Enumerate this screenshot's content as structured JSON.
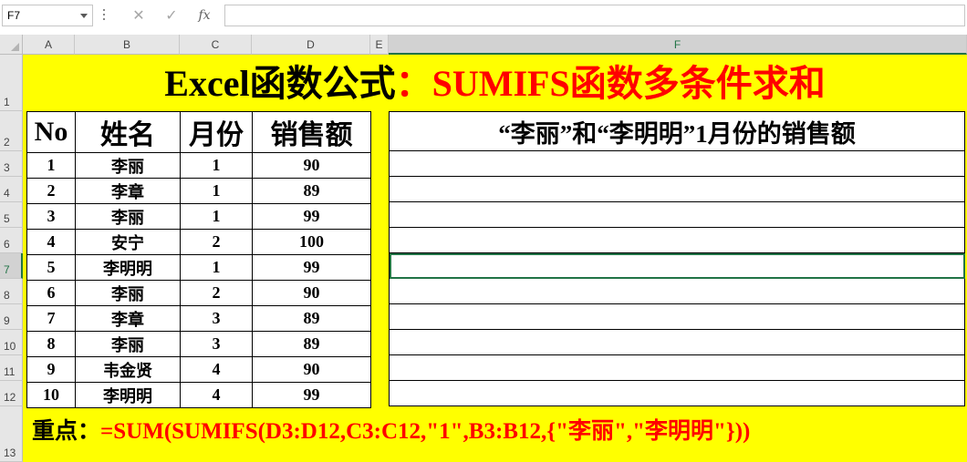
{
  "formula_bar": {
    "name_box": "F7",
    "cancel_glyph": "✕",
    "enter_glyph": "✓",
    "fx_label": "fx",
    "formula": ""
  },
  "columns": [
    "A",
    "B",
    "C",
    "D",
    "E",
    "F"
  ],
  "rows": [
    "1",
    "2",
    "3",
    "4",
    "5",
    "6",
    "7",
    "8",
    "9",
    "10",
    "11",
    "12",
    "13"
  ],
  "selected_cell": "F7",
  "title": {
    "black": "Excel函数公式",
    "red": "：SUMIFS函数多条件求和"
  },
  "table": {
    "headers": [
      "No",
      "姓名",
      "月份",
      "销售额"
    ],
    "rows": [
      [
        "1",
        "李丽",
        "1",
        "90"
      ],
      [
        "2",
        "李章",
        "1",
        "89"
      ],
      [
        "3",
        "李丽",
        "1",
        "99"
      ],
      [
        "4",
        "安宁",
        "2",
        "100"
      ],
      [
        "5",
        "李明明",
        "1",
        "99"
      ],
      [
        "6",
        "李丽",
        "2",
        "90"
      ],
      [
        "7",
        "李章",
        "3",
        "89"
      ],
      [
        "8",
        "李丽",
        "3",
        "89"
      ],
      [
        "9",
        "韦金贤",
        "4",
        "90"
      ],
      [
        "10",
        "李明明",
        "4",
        "99"
      ]
    ]
  },
  "result": {
    "header": "“李丽”和“李明明”1月份的销售额"
  },
  "note": {
    "label": "重点：",
    "formula": "=SUM(SUMIFS(D3:D12,C3:C12,\"1\",B3:B12,{\"李丽\",\"李明明\"}))"
  },
  "colors": {
    "sheet_fill": "#ffff00",
    "accent_red": "#ff0000",
    "selection_green": "#217346"
  }
}
